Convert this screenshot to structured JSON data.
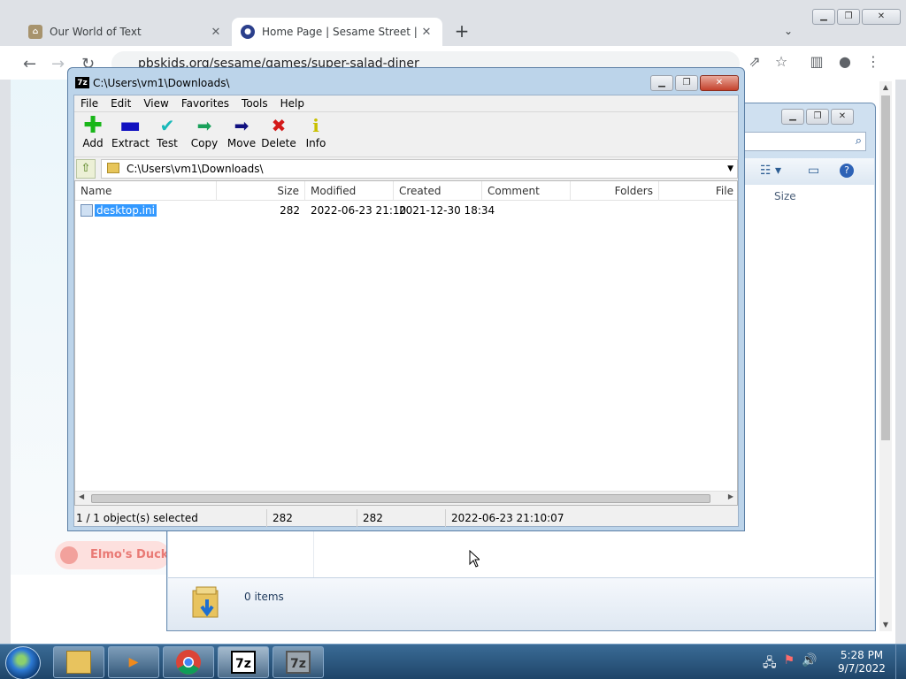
{
  "browser": {
    "tabs": [
      {
        "title": "Our World of Text",
        "close": "✕"
      },
      {
        "title": "Home Page | Sesame Street | PBS",
        "close": "✕"
      }
    ],
    "new_tab": "+",
    "tab_menu": "⌄",
    "url": "pbskids.org/sesame/games/super-salad-diner",
    "page_item": "Elmo's Duck"
  },
  "explorer": {
    "column_size": "Size",
    "item_count": "0 items"
  },
  "sevenzip": {
    "title": "C:\\Users\\vm1\\Downloads\\",
    "icon_text": "7z",
    "menu": [
      "File",
      "Edit",
      "View",
      "Favorites",
      "Tools",
      "Help"
    ],
    "toolbar": [
      {
        "label": "Add",
        "icon": "plus-icon",
        "color": "#19b619"
      },
      {
        "label": "Extract",
        "icon": "minus-icon",
        "color": "#1010c0"
      },
      {
        "label": "Test",
        "icon": "check-icon",
        "color": "#19b9b9"
      },
      {
        "label": "Copy",
        "icon": "double-arrow-icon",
        "color": "#19a05a"
      },
      {
        "label": "Move",
        "icon": "arrow-right-icon",
        "color": "#101080"
      },
      {
        "label": "Delete",
        "icon": "x-icon",
        "color": "#d31919"
      },
      {
        "label": "Info",
        "icon": "info-icon",
        "color": "#c9c000"
      }
    ],
    "path": "C:\\Users\\vm1\\Downloads\\",
    "columns": [
      "Name",
      "Size",
      "Modified",
      "Created",
      "Comment",
      "Folders",
      "File"
    ],
    "rows": [
      {
        "name": "desktop.ini",
        "size": "282",
        "modified": "2022-06-23 21:10",
        "created": "2021-12-30 18:34"
      }
    ],
    "status": {
      "selected": "1 / 1 object(s) selected",
      "size": "282",
      "packed": "282",
      "modified": "2022-06-23 21:10:07"
    }
  },
  "taskbar": {
    "time": "5:28 PM",
    "date": "9/7/2022",
    "apps": [
      "explorer",
      "media-player",
      "chrome",
      "7-zip",
      "7-zip"
    ]
  }
}
